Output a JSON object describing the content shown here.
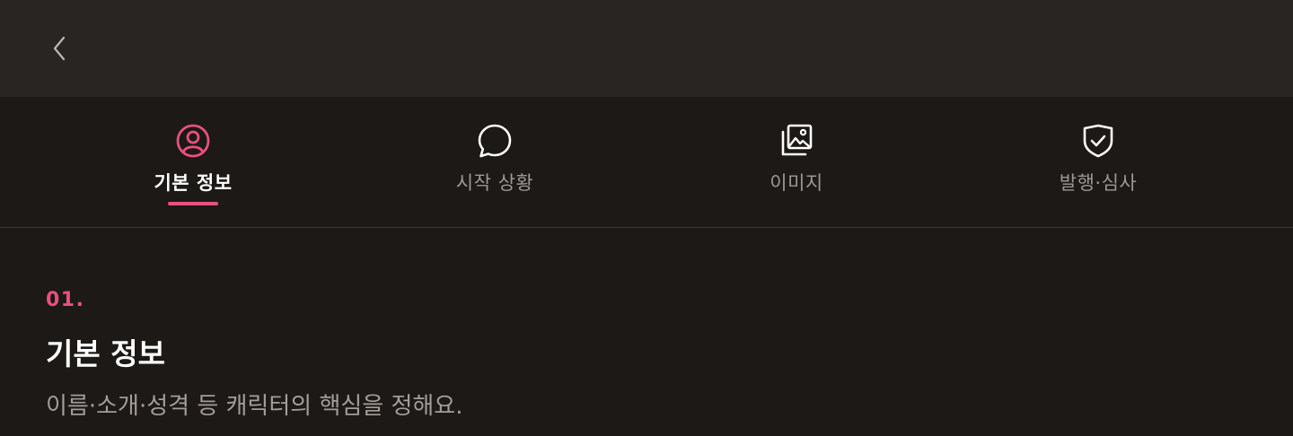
{
  "header": {
    "back_icon": "chevron-left-icon"
  },
  "tabs": [
    {
      "label": "기본 정보",
      "icon": "user-circle-icon",
      "active": true
    },
    {
      "label": "시작 상황",
      "icon": "chat-bubble-icon",
      "active": false
    },
    {
      "label": "이미지",
      "icon": "images-icon",
      "active": false
    },
    {
      "label": "발행·심사",
      "icon": "shield-check-icon",
      "active": false
    }
  ],
  "section": {
    "step": "01.",
    "title": "기본 정보",
    "description": "이름·소개·성격 등 캐릭터의 핵심을 정해요."
  },
  "colors": {
    "accent": "#e9507e",
    "background": "#1c1916",
    "header_bg": "#292522",
    "inactive_text": "#9d9893"
  }
}
